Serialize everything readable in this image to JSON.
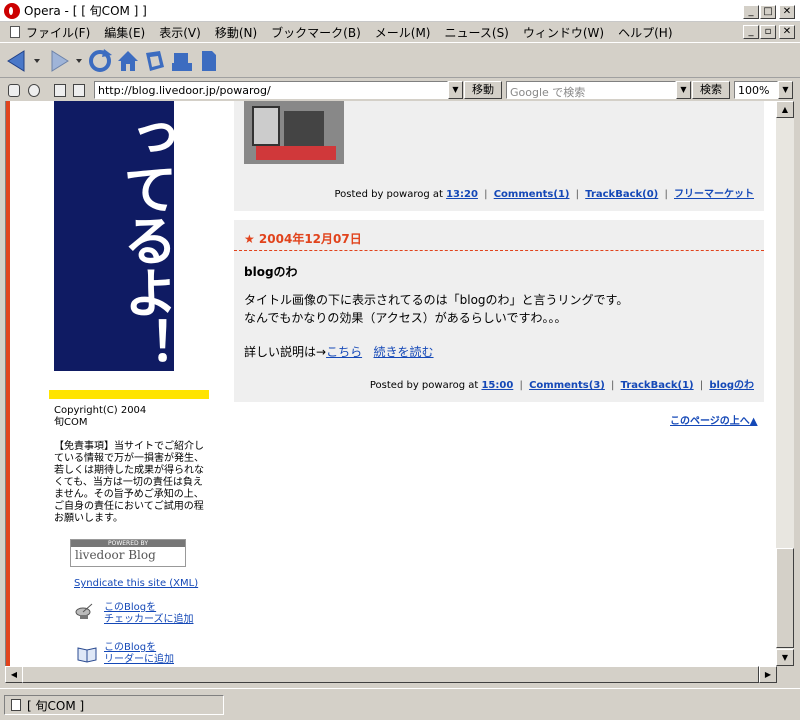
{
  "window": {
    "title": "Opera - [ [ 旬COM ] ]",
    "buttons": {
      "minimize": "_",
      "maximize": "□",
      "close": "✕"
    }
  },
  "menu": {
    "items": [
      "ファイル(F)",
      "編集(E)",
      "表示(V)",
      "移動(N)",
      "ブックマーク(B)",
      "メール(M)",
      "ニュース(S)",
      "ウィンドウ(W)",
      "ヘルプ(H)"
    ]
  },
  "addressbar": {
    "url": "http://blog.livedoor.jp/powarog/",
    "go_label": "移動",
    "search_placeholder": "Google で検索",
    "search_label": "検索",
    "zoom": "100%"
  },
  "sidebar": {
    "banner_text": "ってるよ！",
    "copyright_line1": "Copyright(C) 2004",
    "copyright_line2": "旬COM",
    "disclaimer": "【免責事項】当サイトでご紹介している情報で万が一損害が発生、若しくは期待した成果が得られなくても、当方は一切の責任は負えません。その旨予めご承知の上、ご自身の責任においてご試用の程お願いします。",
    "logo_top": "POWERED BY",
    "logo_main": "livedoor Blog",
    "syndicate": "Syndicate this site (XML)",
    "checker_line1": "このBlogを",
    "checker_line2": "チェッカーズに追加",
    "reader_line1": "このBlogを",
    "reader_line2": "リーダーに追加"
  },
  "posts": [
    {
      "footer_prefix": "Posted by powarog at",
      "time": "13:20",
      "comments": "Comments(1)",
      "trackback": "TrackBack(0)",
      "category": "フリーマーケット"
    },
    {
      "date": "★ 2004年12月07日",
      "title": "blogのわ",
      "body_line1": "タイトル画像の下に表示されてるのは「blogのわ」と言うリングです。",
      "body_line2": "なんでもかなりの効果（アクセス）があるらしいですわ。。。",
      "detail_prefix": "詳しい説明は→",
      "detail_link": "こちら",
      "more_link": "続きを読む",
      "footer_prefix": "Posted by powarog at",
      "time": "15:00",
      "comments": "Comments(3)",
      "trackback": "TrackBack(1)",
      "category": "blogのわ"
    }
  ],
  "page_top": "このページの上へ▲",
  "status": {
    "tab_title": "[ 旬COM ]"
  },
  "colors": {
    "accent": "#e1431c",
    "banner_bg": "#0f1b63",
    "link": "#1448b7",
    "yellow": "#ffe400"
  }
}
